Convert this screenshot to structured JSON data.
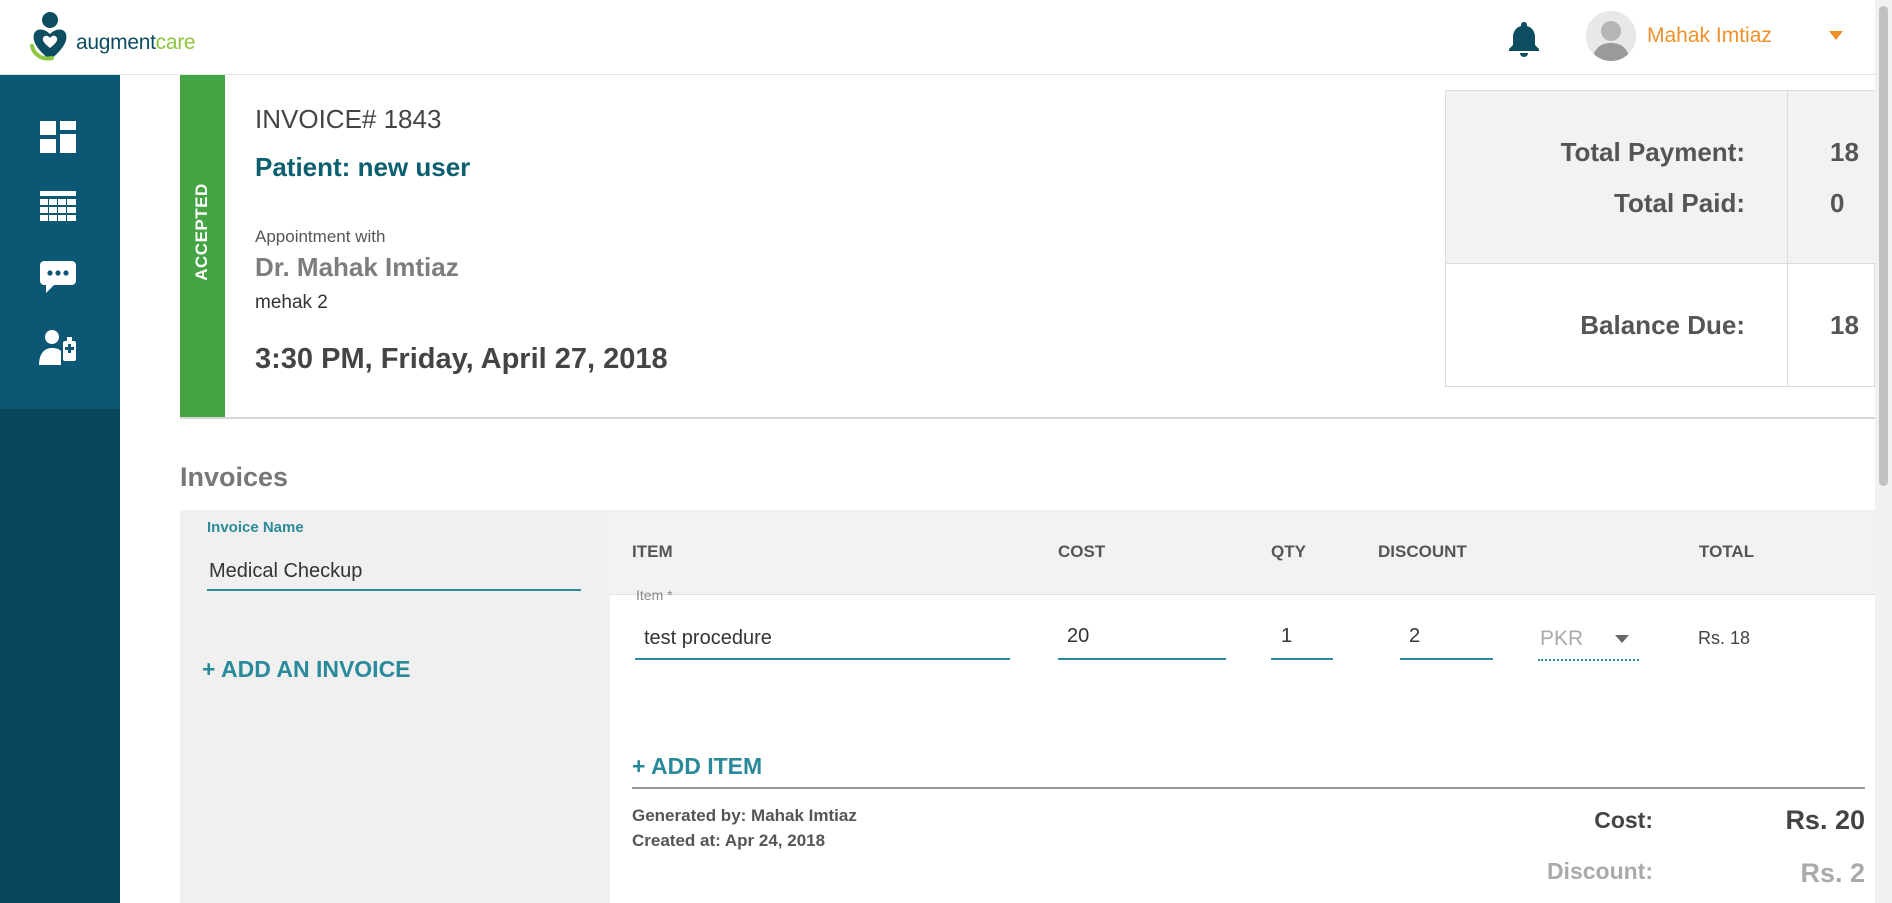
{
  "header": {
    "logo_text_a": "augment",
    "logo_text_b": "care",
    "user_name": "Mahak Imtiaz"
  },
  "sidebar": {
    "items": [
      {
        "icon": "dashboard-icon"
      },
      {
        "icon": "calendar-icon"
      },
      {
        "icon": "chat-icon"
      },
      {
        "icon": "doctor-icon"
      }
    ]
  },
  "invoice": {
    "status": "ACCEPTED",
    "number": "INVOICE# 1843",
    "patient": "Patient: new user",
    "appointment_with_label": "Appointment with",
    "doctor": "Dr. Mahak Imtiaz",
    "doctor_sub": "mehak 2",
    "appointment_time": "3:30 PM, Friday, April 27, 2018"
  },
  "totals": {
    "total_payment_label": "Total Payment:",
    "total_payment_value": "18",
    "total_paid_label": "Total Paid:",
    "total_paid_value": "0",
    "balance_due_label": "Balance Due:",
    "balance_due_value": "18"
  },
  "invoices_section": {
    "title": "Invoices",
    "invoice_name_label": "Invoice Name",
    "invoice_name_value": "Medical Checkup",
    "add_invoice_label": "+ ADD AN INVOICE"
  },
  "items_table": {
    "columns": [
      "ITEM",
      "COST",
      "QTY",
      "DISCOUNT",
      "TOTAL"
    ],
    "item_field_label": "Item *",
    "rows": [
      {
        "item": "test procedure",
        "cost": "20",
        "qty": "1",
        "discount": "2",
        "currency": "PKR",
        "total": "Rs. 18"
      }
    ],
    "add_item_label": "+ ADD ITEM"
  },
  "summary": {
    "generated_by": "Generated by: Mahak Imtiaz",
    "created_at": "Created at: Apr 24, 2018",
    "cost_label": "Cost:",
    "cost_value": "Rs. 20",
    "discount_label": "Discount:",
    "discount_value": "Rs. 2"
  },
  "colors": {
    "sidebar": "#08475c",
    "accent": "#2a8a9a",
    "status_accepted": "#44a444",
    "user_name": "#f0902a"
  }
}
